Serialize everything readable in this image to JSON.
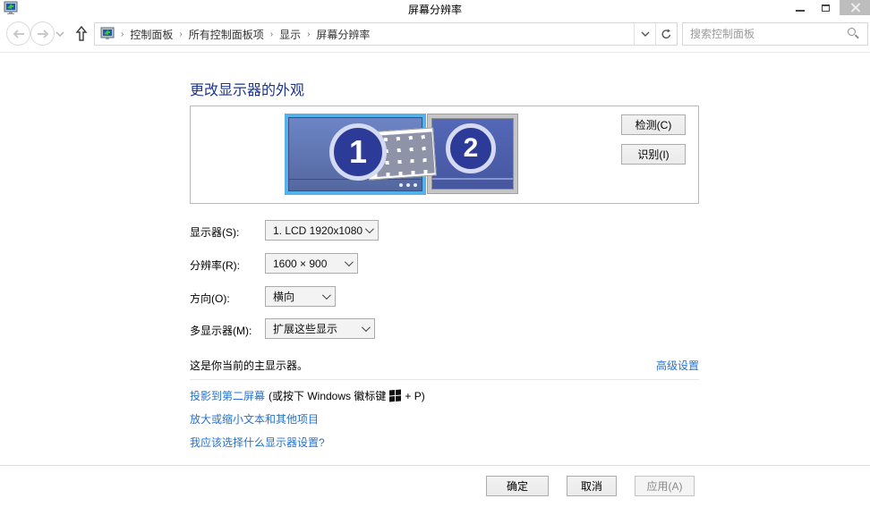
{
  "window": {
    "title": "屏幕分辨率"
  },
  "toolbar": {
    "breadcrumb": [
      "控制面板",
      "所有控制面板项",
      "显示",
      "屏幕分辨率"
    ],
    "separator": "›",
    "search_placeholder": "搜索控制面板"
  },
  "main": {
    "heading": "更改显示器的外观",
    "preview": {
      "monitor1_label": "1",
      "monitor2_label": "2",
      "detect_button": "检测(C)",
      "identify_button": "识别(I)"
    },
    "form": {
      "display_label": "显示器(S):",
      "display_value": "1. LCD 1920x1080",
      "resolution_label": "分辨率(R):",
      "resolution_value": "1600 × 900",
      "orientation_label": "方向(O):",
      "orientation_value": "横向",
      "multi_label": "多显示器(M):",
      "multi_value": "扩展这些显示"
    },
    "primary_note": "这是你当前的主显示器。",
    "advanced_link": "高级设置",
    "links": {
      "project_link": "投影到第二屏幕",
      "project_hint_pre": "(或按下 Windows 徽标键",
      "project_hint_post": "+ P)",
      "dpi_link": "放大或缩小文本和其他项目",
      "help_link": "我应该选择什么显示器设置?"
    }
  },
  "footer": {
    "ok": "确定",
    "cancel": "取消",
    "apply": "应用(A)"
  },
  "colors": {
    "link_blue": "#2672cd",
    "heading_blue": "#1c338f",
    "selection_cyan": "#55b1e9",
    "monitor_screen": "#5a74b6"
  }
}
